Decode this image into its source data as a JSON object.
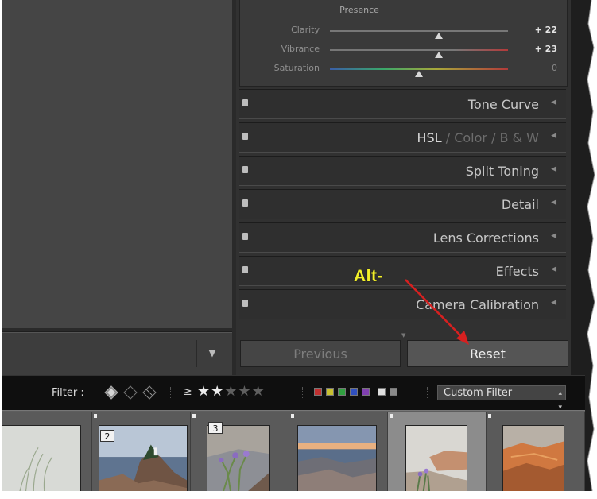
{
  "presence": {
    "title": "Presence",
    "sliders": [
      {
        "label": "Clarity",
        "value": "+ 22",
        "level": 0.61
      },
      {
        "label": "Vibrance",
        "value": "+ 23",
        "level": 0.61
      },
      {
        "label": "Saturation",
        "value": "0",
        "level": 0.5
      }
    ]
  },
  "sections": {
    "tone_curve": "Tone Curve",
    "hsl": "HSL",
    "hsl_sep": "/",
    "color": "Color",
    "bw": "B & W",
    "split_toning": "Split Toning",
    "detail": "Detail",
    "lens_corrections": "Lens Corrections",
    "effects": "Effects",
    "camera_calibration": "Camera Calibration"
  },
  "buttons": {
    "previous": "Previous",
    "reset": "Reset"
  },
  "annotation": {
    "text": "Alt-",
    "color": "#f3f02a",
    "arrow_color": "#d62020"
  },
  "filter": {
    "label": "Filter :",
    "geq": "≥",
    "stars_filled": 2,
    "stars_total": 5,
    "label_colors": [
      "#c03030",
      "#c8c030",
      "#30a040",
      "#3050c0",
      "#8040b0"
    ],
    "custom_filter": "Custom Filter"
  },
  "filmstrip": {
    "thumbs": [
      {
        "badge": ""
      },
      {
        "badge": "2"
      },
      {
        "badge": "3"
      },
      {
        "badge": ""
      },
      {
        "badge": "",
        "selected": true
      },
      {
        "badge": ""
      }
    ]
  }
}
